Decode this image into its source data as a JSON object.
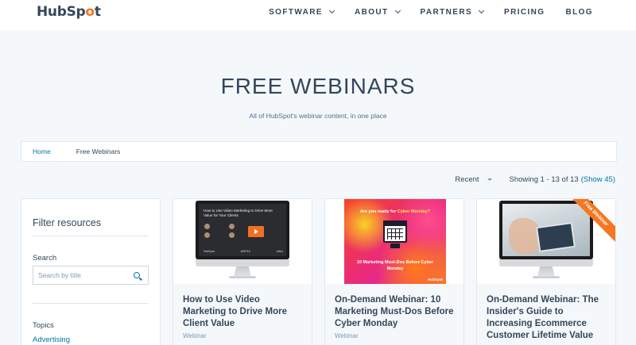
{
  "brand": {
    "name_pre": "HubSp",
    "name_sprocket": "o",
    "name_post": "t"
  },
  "nav": {
    "items": [
      {
        "label": "SOFTWARE",
        "dropdown": true
      },
      {
        "label": "ABOUT",
        "dropdown": true
      },
      {
        "label": "PARTNERS",
        "dropdown": true
      },
      {
        "label": "PRICING",
        "dropdown": false
      },
      {
        "label": "BLOG",
        "dropdown": false
      }
    ]
  },
  "hero": {
    "title": "FREE WEBINARS",
    "subtitle": "All of HubSpot's webinar content, in one place"
  },
  "breadcrumb": {
    "home": "Home",
    "current": "Free Webinars"
  },
  "listing": {
    "sort_value": "Recent",
    "showing_text": "Showing 1 - 13 of 13",
    "show_all_link": "(Show 45)"
  },
  "filter": {
    "title": "Filter resources",
    "search_label": "Search",
    "search_placeholder": "Search by title",
    "topics_label": "Topics",
    "topics": [
      "Advertising"
    ]
  },
  "cards": [
    {
      "title": "How to Use Video Marketing to Drive More Client Value",
      "type": "Webinar",
      "thumb": {
        "slide_title": "How to Use Video Marketing to Drive More Value for Your Clients",
        "logos": [
          "HubSpot",
          "WISTIA",
          "video"
        ]
      }
    },
    {
      "title": "On-Demand Webinar: 10 Marketing Must-Dos Before Cyber Monday",
      "type": "Webinar",
      "thumb": {
        "question_pre": "Are you ready for",
        "question_highlight": "Cyber Monday?",
        "subtitle": "10 Marketing Must-Dos Before Cyber Monday",
        "brand": "HubSpot"
      }
    },
    {
      "title": "On-Demand Webinar: The Insider's Guide to Increasing Ecommerce Customer Lifetime Value",
      "type": "Webinar",
      "thumb": {
        "ribbon": "Free Webinar"
      }
    }
  ],
  "colors": {
    "accent": "#f57722",
    "link": "#0073aa",
    "text": "#33475b",
    "background": "#f5f8fa"
  }
}
